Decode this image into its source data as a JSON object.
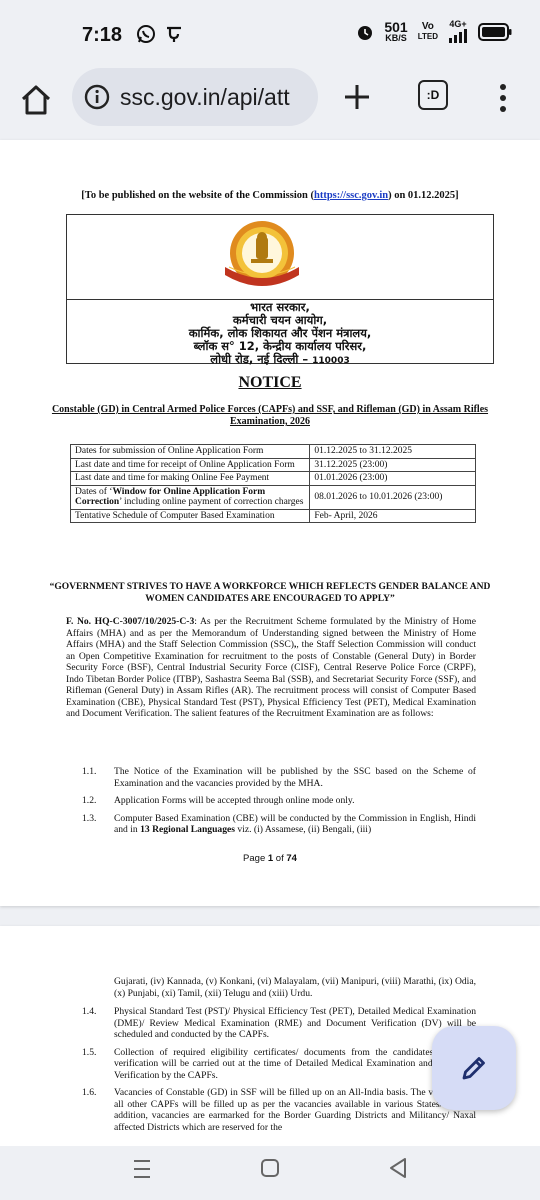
{
  "status_bar": {
    "time": "7:18",
    "left_icons": [
      "whatsapp-icon",
      "pe-app-icon"
    ],
    "net_speed_value": "501",
    "net_speed_unit": "KB/S",
    "volte_top": "Vo",
    "volte_bottom": "LTED",
    "network": "4G+"
  },
  "browser": {
    "url": "ssc.gov.in/api/att",
    "tab_label": ":D"
  },
  "page1": {
    "publish_prefix": "[To be published on the website of the Commission (",
    "publish_link": "https://ssc.gov.in",
    "publish_suffix": ") on 01.12.2025]",
    "logo_text": "कर्मचारी चयन आयोग",
    "logo_band": "SELECTION COMMISSION",
    "address": {
      "line1": "भारत सरकार,",
      "line2": "कर्मचारी चयन आयोग,",
      "line3": "कार्मिक, लोक शिकायत और पेंशन मंत्रालय,",
      "line4": "ब्लॉक स° 12, केन्द्रीय कार्यालय परिसर,",
      "line5": "लोधी रोड, नई दिल्ली – ",
      "pin": "110003"
    },
    "notice_title": "NOTICE",
    "exam_title": "Constable (GD) in Central Armed Police Forces (CAPFs) and SSF, and  Rifleman (GD) in Assam Rifles Examination, 2026",
    "dates": [
      {
        "label": "Dates for submission of Online Application Form",
        "value": "01.12.2025 to 31.12.2025"
      },
      {
        "label": "Last date and time for receipt of Online Application Form",
        "value": "31.12.2025 (23:00)"
      },
      {
        "label": "Last date and time for making Online Fee Payment",
        "value": "01.01.2026 (23:00)"
      },
      {
        "label_prefix": "Dates of ‘",
        "label_bold": "Window for Online Application Form Correction",
        "label_suffix": "’ including online payment of correction charges",
        "value": "08.01.2026 to 10.01.2026 (23:00)"
      },
      {
        "label": "Tentative Schedule of Computer Based Examination",
        "value": "Feb- April, 2026"
      }
    ],
    "quote": "“GOVERNMENT STRIVES TO HAVE A WORKFORCE WHICH REFLECTS GENDER BALANCE AND WOMEN CANDIDATES ARE ENCOURAGED TO APPLY”",
    "file_no": "F. No. HQ-C-3007/10/2025-C-3",
    "para_a": ": As per the Recruitment Scheme formulated by the Ministry of Home Affairs (MHA) and as per the Memorandum of Understanding signed between the Ministry of Home Affairs (MHA) and the Staff Selection Commission (SSC)",
    "para_b": ", the Staff Selection Commission will conduct an Open Competitive Examination for recruitment to the posts of Constable (General Duty) in Border Security Force (BSF), Central Industrial Security Force (CISF), Central Reserve Police Force (CRPF), Indo Tibetan Border Police (ITBP), Sashastra Seema Bal (SSB), and Secretariat Security Force (SSF), and Rifleman (General Duty) in Assam Rifles (AR). The recruitment process will consist of Computer Based Examination (CBE), Physical Standard Test (PST), Physical Efficiency Test (PET), Medical Examination and Document Verification. The salient features of the Recruitment Examination are as follows:",
    "items": [
      {
        "num": "1.1.",
        "text": "The Notice of the Examination will be published by the SSC based on the Scheme of Examination and the vacancies provided by the MHA."
      },
      {
        "num": "1.2.",
        "text": "Application Forms will be accepted through online mode only."
      },
      {
        "num": "1.3.",
        "text_a": "Computer Based Examination (CBE) will be conducted by the Commission in English, Hindi and in ",
        "text_bold": "13 Regional Languages",
        "text_b": " viz. (i) Assamese, (ii) Bengali, (iii)"
      }
    ],
    "page_prefix": "Page ",
    "page_current": "1",
    "page_of": " of ",
    "page_total": "74"
  },
  "page2": {
    "continuation": "Gujarati, (iv) Kannada, (v) Konkani, (vi) Malayalam, (vii) Manipuri, (viii) Marathi, (ix) Odia, (x) Punjabi, (xi) Tamil, (xii) Telugu and (xiii) Urdu.",
    "items": [
      {
        "num": "1.4.",
        "text": "Physical Standard Test (PST)/ Physical Efficiency Test (PET), Detailed Medical Examination (DME)/ Review Medical Examination (RME) and Document Verification (DV) will be scheduled and conducted by the CAPFs."
      },
      {
        "num": "1.5.",
        "text": "Collection of required eligibility certificates/ documents from the candidates and their verification will be carried out at the time of Detailed Medical Examination and Document Verification by the CAPFs."
      },
      {
        "num": "1.6.",
        "text": "Vacancies of Constable (GD) in SSF will be filled up on an All-India basis. The vacancies in all other CAPFs will be filled up as per the vacancies available in various States/ UTs. In addition, vacancies are earmarked for the Border Guarding Districts and Militancy/ Naxal affected Districts which are reserved for the"
      }
    ]
  },
  "colors": {
    "link": "#1a3cc4",
    "fab": "#d6dcf6",
    "url_pill": "#dfe2ea",
    "chrome_bg": "#eef0f4"
  },
  "nav": {
    "icons": [
      "recents-icon",
      "home-circle-icon",
      "back-triangle-icon"
    ]
  }
}
